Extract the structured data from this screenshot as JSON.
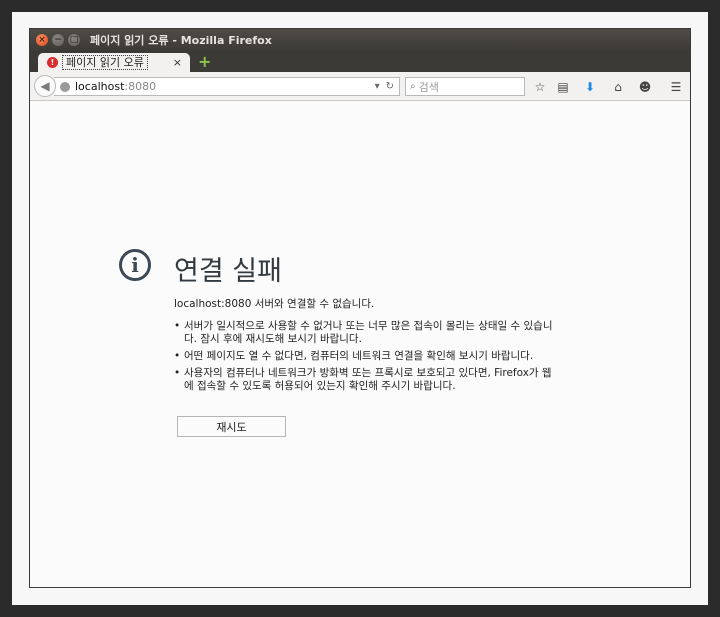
{
  "window": {
    "title": "페이지 읽기 오류 - Mozilla Firefox",
    "close_glyph": "×",
    "minimize_glyph": "−",
    "maximize_glyph": "□"
  },
  "tab": {
    "label": "페이지 읽기 오류",
    "icon": "error-icon",
    "close_glyph": "×",
    "new_tab_glyph": "+"
  },
  "navbar": {
    "url_host": "localhost",
    "url_port": ":8080",
    "dropmarker_glyph": "▾",
    "reload_glyph": "↻",
    "search_placeholder": "검색",
    "search_glyph": "⌕"
  },
  "toolbar": {
    "bookmark_glyph": "☆",
    "library_glyph": "▤",
    "download_glyph": "⬇",
    "home_glyph": "⌂",
    "hello_glyph": "☻",
    "menu_glyph": "☰"
  },
  "error_page": {
    "icon_glyph": "i",
    "title": "연결 실패",
    "message": "localhost:8080 서버와 연결할 수 없습니다.",
    "suggestions": [
      "서버가 일시적으로 사용할 수 없거나 또는 너무 많은 접속이 몰리는 상태일 수 있습니다. 잠시 후에 재시도해 보시기 바랍니다.",
      "어떤 페이지도 열 수 없다면, 컴퓨터의 네트워크 연결을 확인해 보시기 바랍니다.",
      "사용자의 컴퓨터나 네트워크가 방화벽 또는 프록시로 보호되고 있다면, Firefox가 웹에 접속할 수 있도록 허용되어 있는지 확인해 주시기 바랍니다."
    ],
    "retry_label": "재시도"
  },
  "colors": {
    "titlebar": "#3c3a36",
    "close_button": "#dd4814",
    "error_icon": "#3d4a55",
    "download_accent": "#1e88e5",
    "new_tab_accent": "#8bc34a"
  }
}
